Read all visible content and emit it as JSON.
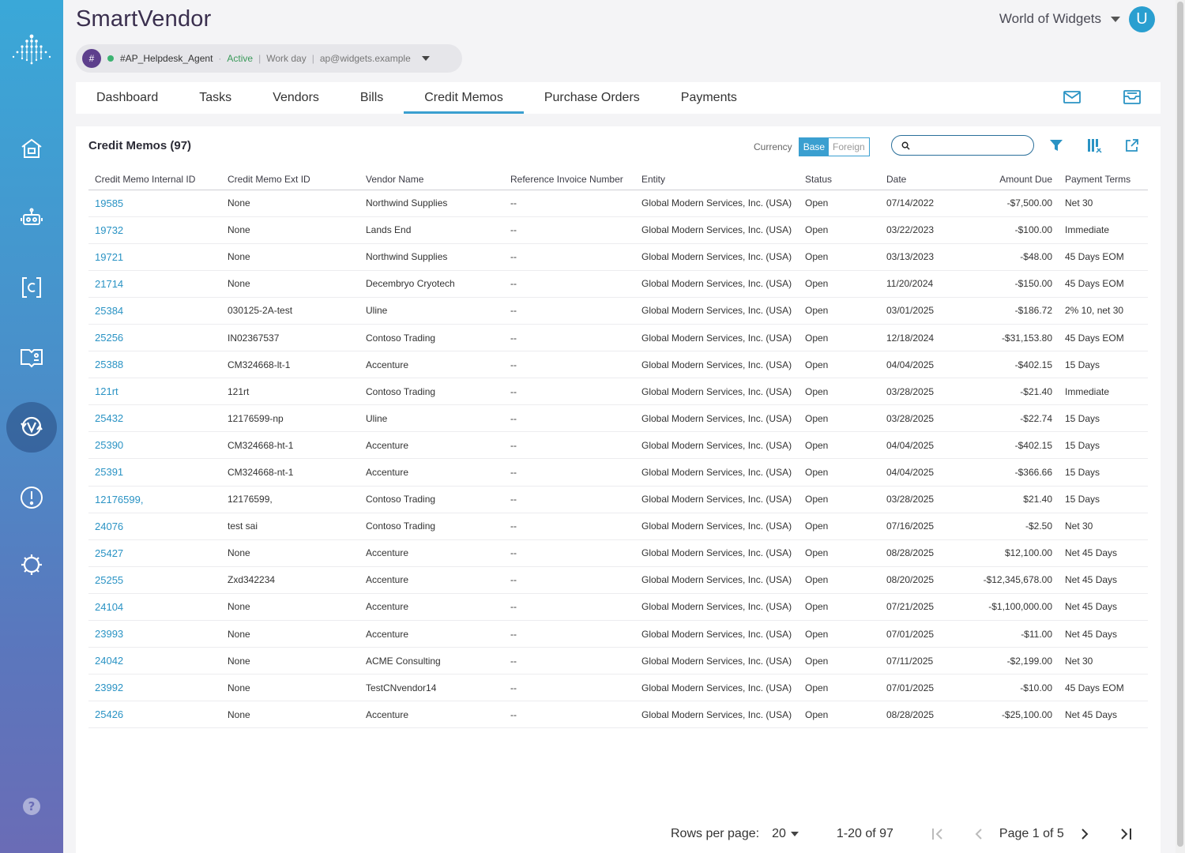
{
  "app": {
    "title": "SmartVendor",
    "org": "World of Widgets",
    "avatar_letter": "U"
  },
  "agent": {
    "hash": "#",
    "name": "#AP_Helpdesk_Agent",
    "status": "Active",
    "schedule": "Work day",
    "email": "ap@widgets.example"
  },
  "sidebar": {
    "items": [
      "home-icon",
      "robot-icon",
      "credit-icon",
      "book-icon",
      "vendor-icon",
      "alert-icon",
      "settings-icon",
      "help-icon"
    ]
  },
  "tabs": [
    {
      "label": "Dashboard"
    },
    {
      "label": "Tasks"
    },
    {
      "label": "Vendors"
    },
    {
      "label": "Bills"
    },
    {
      "label": "Credit Memos",
      "selected": true
    },
    {
      "label": "Purchase Orders"
    },
    {
      "label": "Payments"
    }
  ],
  "card": {
    "title": "Credit Memos (97)",
    "currency_label": "Currency",
    "currency_options": [
      "Base",
      "Foreign"
    ],
    "currency_selected": "Base",
    "search_placeholder": ""
  },
  "table": {
    "columns": [
      "Credit Memo Internal ID",
      "Credit Memo Ext ID",
      "Vendor Name",
      "Reference Invoice Number",
      "Entity",
      "Status",
      "Date",
      "Amount Due",
      "Payment Terms"
    ],
    "rows": [
      [
        "19585",
        "None",
        "Northwind Supplies",
        "--",
        "Global Modern Services, Inc. (USA)",
        "Open",
        "07/14/2022",
        "-$7,500.00",
        "Net 30"
      ],
      [
        "19732",
        "None",
        "Lands End",
        "--",
        "Global Modern Services, Inc. (USA)",
        "Open",
        "03/22/2023",
        "-$100.00",
        "Immediate"
      ],
      [
        "19721",
        "None",
        "Northwind Supplies",
        "--",
        "Global Modern Services, Inc. (USA)",
        "Open",
        "03/13/2023",
        "-$48.00",
        "45 Days EOM"
      ],
      [
        "21714",
        "None",
        "Decembryo Cryotech",
        "--",
        "Global Modern Services, Inc. (USA)",
        "Open",
        "11/20/2024",
        "-$150.00",
        "45 Days EOM"
      ],
      [
        "25384",
        "030125-2A-test",
        "Uline",
        "--",
        "Global Modern Services, Inc. (USA)",
        "Open",
        "03/01/2025",
        "-$186.72",
        "2% 10, net 30"
      ],
      [
        "25256",
        "IN02367537",
        "Contoso Trading",
        "--",
        "Global Modern Services, Inc. (USA)",
        "Open",
        "12/18/2024",
        "-$31,153.80",
        "45 Days EOM"
      ],
      [
        "25388",
        "CM324668-lt-1",
        "Accenture",
        "--",
        "Global Modern Services, Inc. (USA)",
        "Open",
        "04/04/2025",
        "-$402.15",
        "15 Days"
      ],
      [
        "121rt",
        "121rt",
        "Contoso Trading",
        "--",
        "Global Modern Services, Inc. (USA)",
        "Open",
        "03/28/2025",
        "-$21.40",
        "Immediate"
      ],
      [
        "25432",
        "12176599-np",
        "Uline",
        "--",
        "Global Modern Services, Inc. (USA)",
        "Open",
        "03/28/2025",
        "-$22.74",
        "15 Days"
      ],
      [
        "25390",
        "CM324668-ht-1",
        "Accenture",
        "--",
        "Global Modern Services, Inc. (USA)",
        "Open",
        "04/04/2025",
        "-$402.15",
        "15 Days"
      ],
      [
        "25391",
        "CM324668-nt-1",
        "Accenture",
        "--",
        "Global Modern Services, Inc. (USA)",
        "Open",
        "04/04/2025",
        "-$366.66",
        "15 Days"
      ],
      [
        "12176599,",
        "12176599,",
        "Contoso Trading",
        "--",
        "Global Modern Services, Inc. (USA)",
        "Open",
        "03/28/2025",
        "$21.40",
        "15 Days"
      ],
      [
        "24076",
        "test sai",
        "Contoso Trading",
        "--",
        "Global Modern Services, Inc. (USA)",
        "Open",
        "07/16/2025",
        "-$2.50",
        "Net 30"
      ],
      [
        "25427",
        "None",
        "Accenture",
        "--",
        "Global Modern Services, Inc. (USA)",
        "Open",
        "08/28/2025",
        "$12,100.00",
        "Net 45 Days"
      ],
      [
        "25255",
        "Zxd342234",
        "Accenture",
        "--",
        "Global Modern Services, Inc. (USA)",
        "Open",
        "08/20/2025",
        "-$12,345,678.00",
        "Net 45 Days"
      ],
      [
        "24104",
        "None",
        "Accenture",
        "--",
        "Global Modern Services, Inc. (USA)",
        "Open",
        "07/21/2025",
        "-$1,100,000.00",
        "Net 45 Days"
      ],
      [
        "23993",
        "None",
        "Accenture",
        "--",
        "Global Modern Services, Inc. (USA)",
        "Open",
        "07/01/2025",
        "-$11.00",
        "Net 45 Days"
      ],
      [
        "24042",
        "None",
        "ACME Consulting",
        "--",
        "Global Modern Services, Inc. (USA)",
        "Open",
        "07/11/2025",
        "-$2,199.00",
        "Net 30"
      ],
      [
        "23992",
        "None",
        "TestCNvendor14",
        "--",
        "Global Modern Services, Inc. (USA)",
        "Open",
        "07/01/2025",
        "-$10.00",
        "45 Days EOM"
      ],
      [
        "25426",
        "None",
        "Accenture",
        "--",
        "Global Modern Services, Inc. (USA)",
        "Open",
        "08/28/2025",
        "-$25,100.00",
        "Net 45 Days"
      ]
    ]
  },
  "pager": {
    "rows_per_page_label": "Rows per page:",
    "rows_per_page": "20",
    "range": "1-20 of 97",
    "page": "Page 1 of 5"
  },
  "colors": {
    "accent": "#3a9fd0",
    "link": "#2a93c4",
    "title": "#3a2f4e"
  }
}
